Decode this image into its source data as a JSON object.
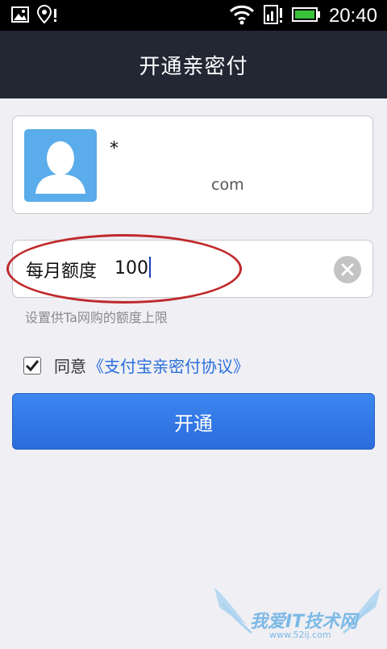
{
  "status_bar": {
    "time": "20:40"
  },
  "title": "开通亲密付",
  "user": {
    "name": "*",
    "account": "com"
  },
  "amount": {
    "label": "每月额度",
    "value": "100"
  },
  "hint": "设置供Ta网购的额度上限",
  "agreement": {
    "checked": true,
    "prefix": "同意",
    "link": "《支付宝亲密付协议》"
  },
  "submit_label": "开通",
  "watermark": {
    "text": "我爱IT技术网",
    "url": "www.52ij.com"
  },
  "colors": {
    "title_bar": "#232734",
    "button": "#2f74e0",
    "link": "#2b6fdb",
    "avatar": "#5aacea"
  }
}
